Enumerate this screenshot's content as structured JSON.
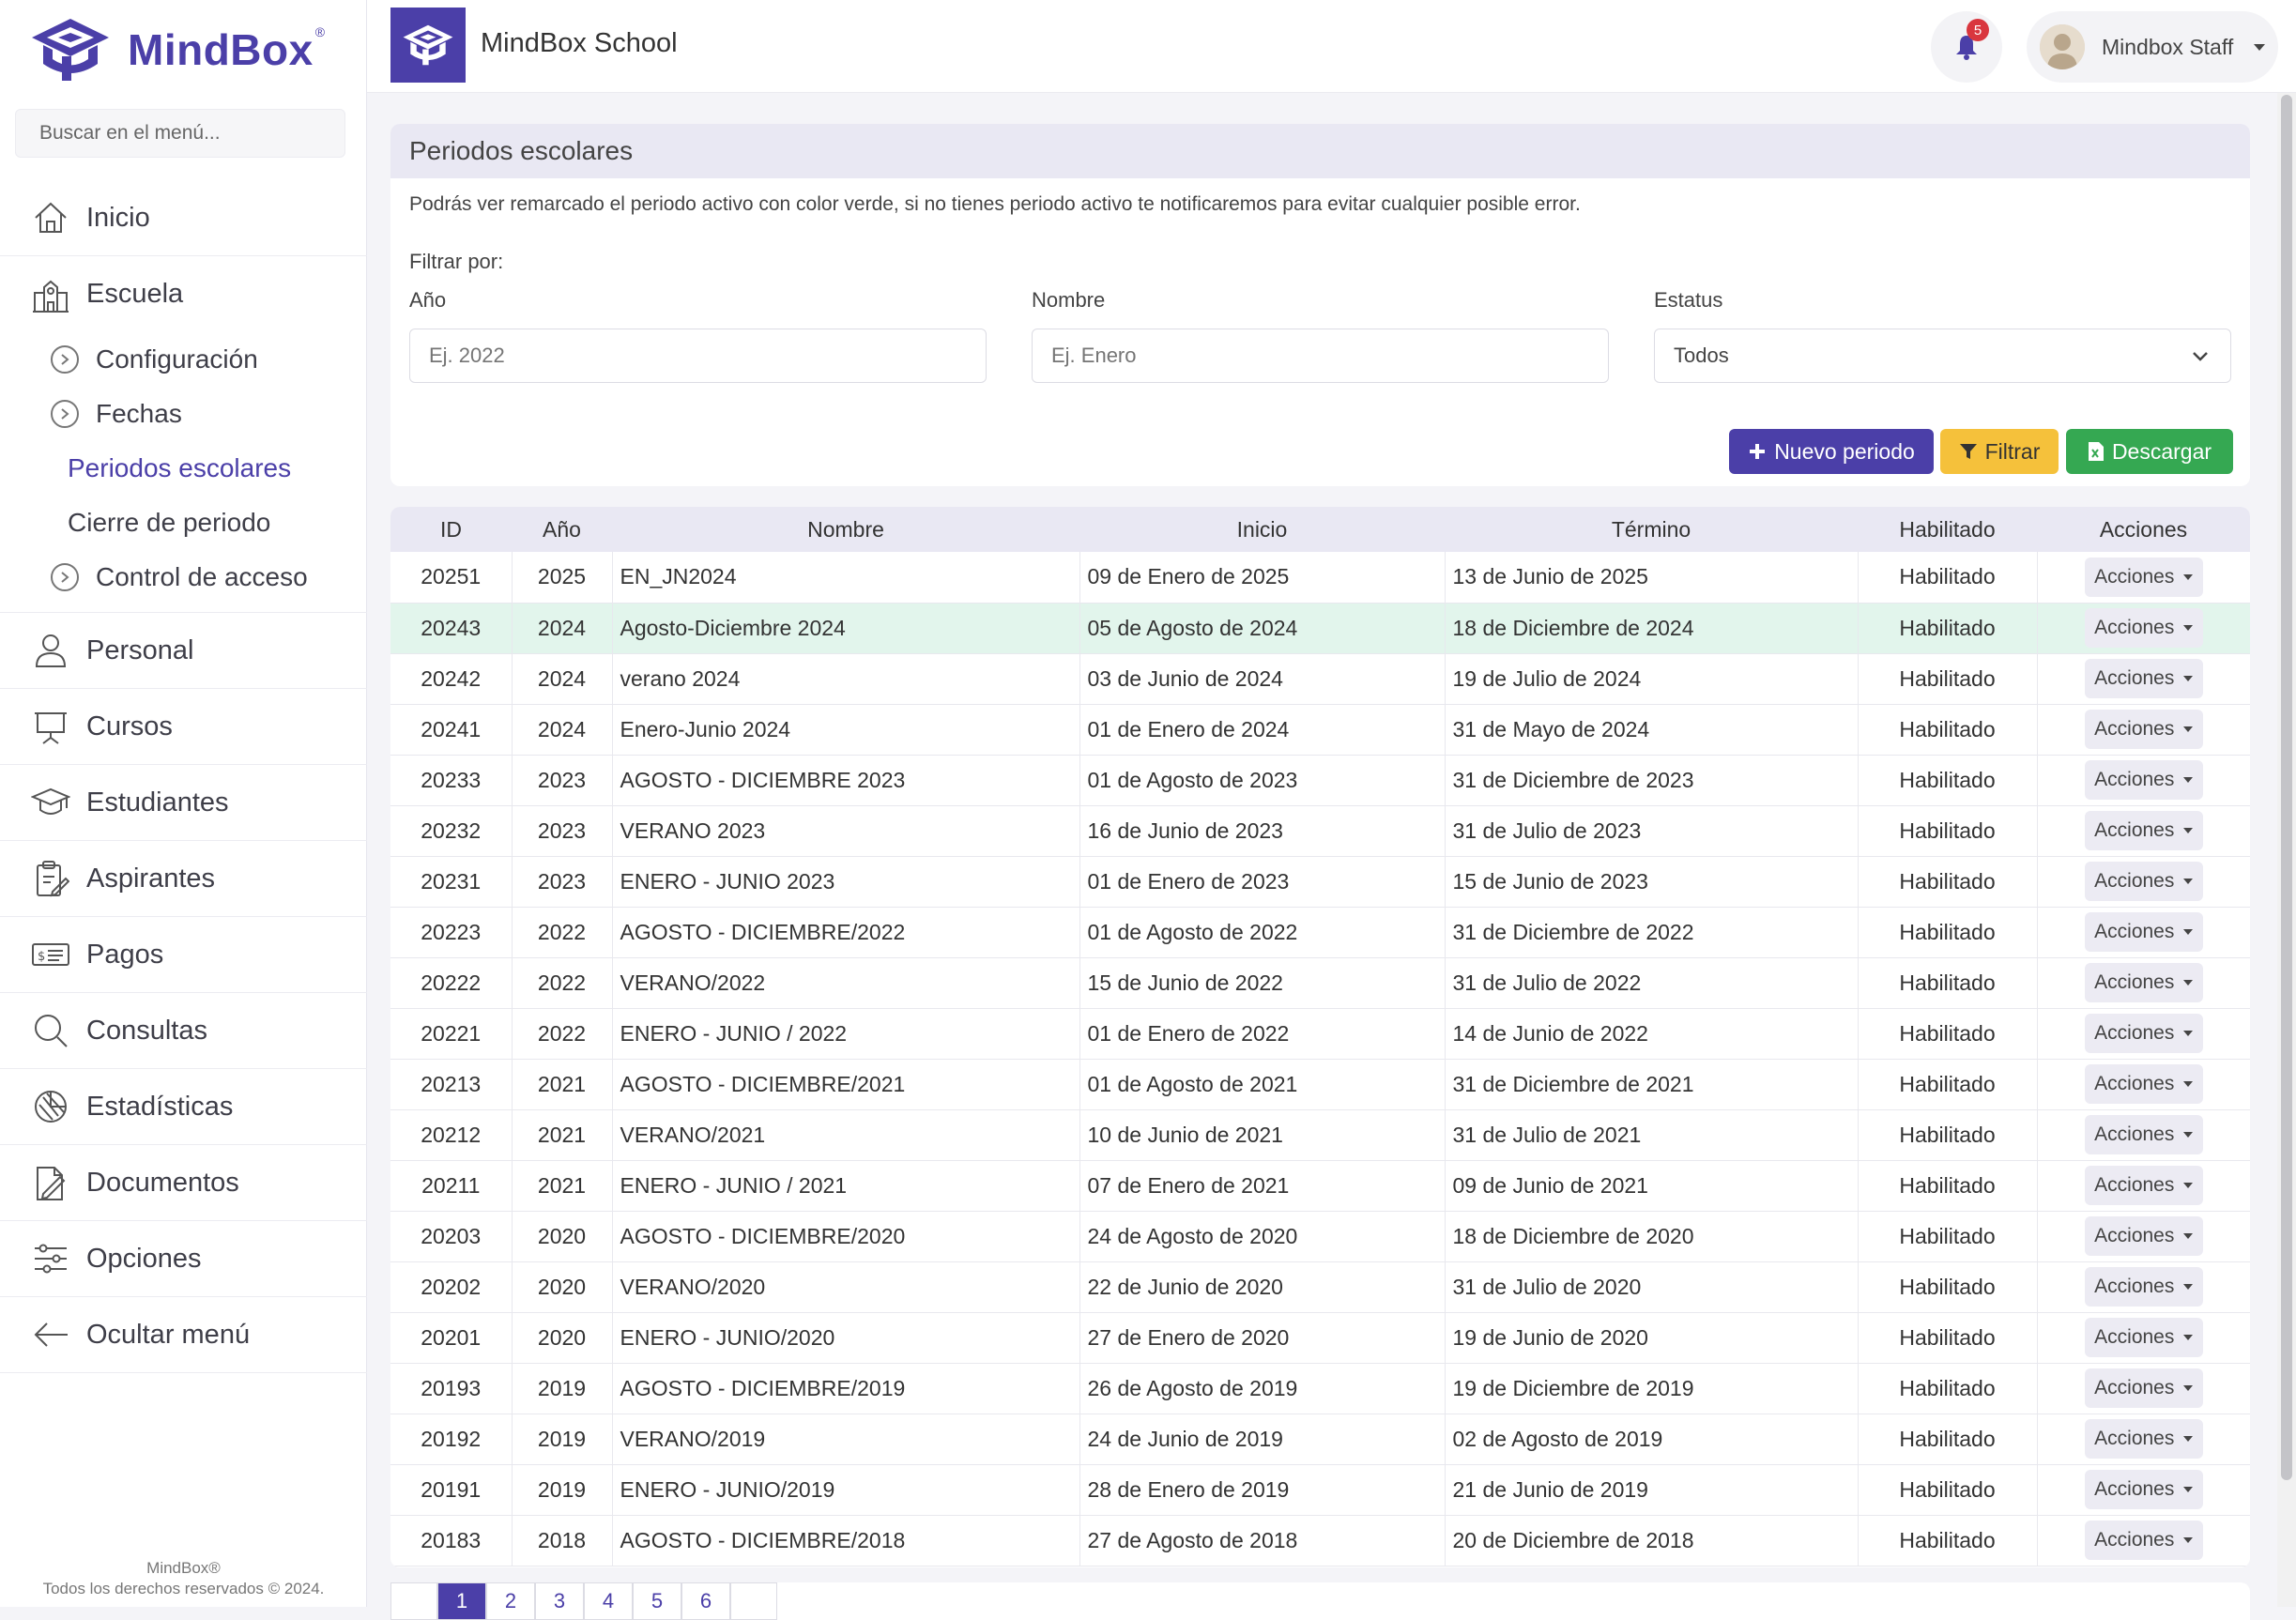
{
  "brand": {
    "name": "MindBox",
    "reg": "®"
  },
  "search": {
    "placeholder": "Buscar en el menú..."
  },
  "nav": {
    "inicio": "Inicio",
    "escuela": "Escuela",
    "escuela_sub": {
      "configuracion": "Configuración",
      "fechas": "Fechas",
      "periodos": "Periodos escolares",
      "cierre": "Cierre de periodo",
      "control": "Control de acceso"
    },
    "personal": "Personal",
    "cursos": "Cursos",
    "estudiantes": "Estudiantes",
    "aspirantes": "Aspirantes",
    "pagos": "Pagos",
    "consultas": "Consultas",
    "estadisticas": "Estadísticas",
    "documentos": "Documentos",
    "opciones": "Opciones",
    "ocultar": "Ocultar menú"
  },
  "footer": {
    "line1": "MindBox®",
    "line2": "Todos los derechos reservados © 2024."
  },
  "header": {
    "school": "MindBox School",
    "notifications": "5",
    "user": "Mindbox Staff"
  },
  "filter_card": {
    "title": "Periodos escolares",
    "description": "Podrás ver remarcado el periodo activo con color verde, si no tienes periodo activo te notificaremos para evitar cualquier posible error.",
    "filter_by": "Filtrar por:",
    "year_label": "Año",
    "year_placeholder": "Ej. 2022",
    "name_label": "Nombre",
    "name_placeholder": "Ej. Enero",
    "status_label": "Estatus",
    "status_value": "Todos",
    "btn_new": "Nuevo periodo",
    "btn_filter": "Filtrar",
    "btn_download": "Descargar"
  },
  "table": {
    "headers": {
      "id": "ID",
      "year": "Año",
      "name": "Nombre",
      "start": "Inicio",
      "end": "Término",
      "enabled": "Habilitado",
      "actions": "Acciones"
    },
    "action_label": "Acciones",
    "rows": [
      {
        "id": "20251",
        "year": "2025",
        "name": "EN_JN2024",
        "start": "09 de Enero de 2025",
        "end": "13 de Junio de 2025",
        "enabled": "Habilitado",
        "active": false
      },
      {
        "id": "20243",
        "year": "2024",
        "name": "Agosto-Diciembre 2024",
        "start": "05 de Agosto de 2024",
        "end": "18 de Diciembre de 2024",
        "enabled": "Habilitado",
        "active": true
      },
      {
        "id": "20242",
        "year": "2024",
        "name": "verano 2024",
        "start": "03 de Junio de 2024",
        "end": "19 de Julio de 2024",
        "enabled": "Habilitado",
        "active": false
      },
      {
        "id": "20241",
        "year": "2024",
        "name": "Enero-Junio 2024",
        "start": "01 de Enero de 2024",
        "end": "31 de Mayo de 2024",
        "enabled": "Habilitado",
        "active": false
      },
      {
        "id": "20233",
        "year": "2023",
        "name": "AGOSTO - DICIEMBRE 2023",
        "start": "01 de Agosto de 2023",
        "end": "31 de Diciembre de 2023",
        "enabled": "Habilitado",
        "active": false
      },
      {
        "id": "20232",
        "year": "2023",
        "name": "VERANO 2023",
        "start": "16 de Junio de 2023",
        "end": "31 de Julio de 2023",
        "enabled": "Habilitado",
        "active": false
      },
      {
        "id": "20231",
        "year": "2023",
        "name": "ENERO - JUNIO 2023",
        "start": "01 de Enero de 2023",
        "end": "15 de Junio de 2023",
        "enabled": "Habilitado",
        "active": false
      },
      {
        "id": "20223",
        "year": "2022",
        "name": "AGOSTO - DICIEMBRE/2022",
        "start": "01 de Agosto de 2022",
        "end": "31 de Diciembre de 2022",
        "enabled": "Habilitado",
        "active": false
      },
      {
        "id": "20222",
        "year": "2022",
        "name": "VERANO/2022",
        "start": "15 de Junio de 2022",
        "end": "31 de Julio de 2022",
        "enabled": "Habilitado",
        "active": false
      },
      {
        "id": "20221",
        "year": "2022",
        "name": "ENERO - JUNIO / 2022",
        "start": "01 de Enero de 2022",
        "end": "14 de Junio de 2022",
        "enabled": "Habilitado",
        "active": false
      },
      {
        "id": "20213",
        "year": "2021",
        "name": "AGOSTO - DICIEMBRE/2021",
        "start": "01 de Agosto de 2021",
        "end": "31 de Diciembre de 2021",
        "enabled": "Habilitado",
        "active": false
      },
      {
        "id": "20212",
        "year": "2021",
        "name": "VERANO/2021",
        "start": "10 de Junio de 2021",
        "end": "31 de Julio de 2021",
        "enabled": "Habilitado",
        "active": false
      },
      {
        "id": "20211",
        "year": "2021",
        "name": "ENERO - JUNIO / 2021",
        "start": "07 de Enero de 2021",
        "end": "09 de Junio de 2021",
        "enabled": "Habilitado",
        "active": false
      },
      {
        "id": "20203",
        "year": "2020",
        "name": "AGOSTO - DICIEMBRE/2020",
        "start": "24 de Agosto de 2020",
        "end": "18 de Diciembre de 2020",
        "enabled": "Habilitado",
        "active": false
      },
      {
        "id": "20202",
        "year": "2020",
        "name": "VERANO/2020",
        "start": "22 de Junio de 2020",
        "end": "31 de Julio de 2020",
        "enabled": "Habilitado",
        "active": false
      },
      {
        "id": "20201",
        "year": "2020",
        "name": "ENERO - JUNIO/2020",
        "start": "27 de Enero de 2020",
        "end": "19 de Junio de 2020",
        "enabled": "Habilitado",
        "active": false
      },
      {
        "id": "20193",
        "year": "2019",
        "name": "AGOSTO - DICIEMBRE/2019",
        "start": "26 de Agosto de 2019",
        "end": "19 de Diciembre de 2019",
        "enabled": "Habilitado",
        "active": false
      },
      {
        "id": "20192",
        "year": "2019",
        "name": "VERANO/2019",
        "start": "24 de Junio de 2019",
        "end": "02 de Agosto de 2019",
        "enabled": "Habilitado",
        "active": false
      },
      {
        "id": "20191",
        "year": "2019",
        "name": "ENERO - JUNIO/2019",
        "start": "28 de Enero de 2019",
        "end": "21 de Junio de 2019",
        "enabled": "Habilitado",
        "active": false
      },
      {
        "id": "20183",
        "year": "2018",
        "name": "AGOSTO - DICIEMBRE/2018",
        "start": "27 de Agosto de 2018",
        "end": "20 de Diciembre de 2018",
        "enabled": "Habilitado",
        "active": false
      }
    ]
  },
  "pagination": {
    "pages": [
      "1",
      "2",
      "3",
      "4",
      "5",
      "6"
    ],
    "current": "1"
  },
  "colors": {
    "brand": "#4b3fa8",
    "active_row": "#e2f5ec",
    "filter": "#f5c13b",
    "download": "#35a852",
    "badge": "#d9363e"
  }
}
